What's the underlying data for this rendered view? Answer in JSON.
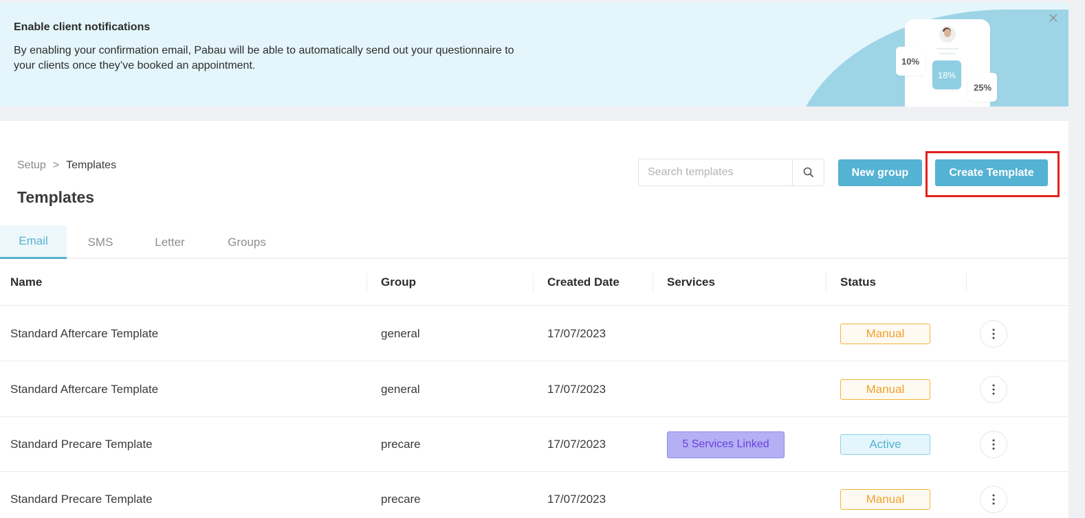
{
  "banner": {
    "title": "Enable client notifications",
    "text": "By enabling your confirmation email, Pabau will be able to automatically send out your questionnaire to your clients once they’ve booked an appointment.",
    "stats": [
      "10%",
      "18%",
      "25%"
    ]
  },
  "breadcrumb": {
    "parent": "Setup",
    "separator": ">",
    "current": "Templates"
  },
  "page_title": "Templates",
  "search": {
    "placeholder": "Search templates",
    "value": ""
  },
  "buttons": {
    "new_group": "New group",
    "create_template": "Create Template"
  },
  "tabs": [
    {
      "label": "Email",
      "active": true
    },
    {
      "label": "SMS",
      "active": false
    },
    {
      "label": "Letter",
      "active": false
    },
    {
      "label": "Groups",
      "active": false
    }
  ],
  "table": {
    "columns": [
      "Name",
      "Group",
      "Created Date",
      "Services",
      "Status"
    ],
    "rows": [
      {
        "name": "Standard Aftercare Template",
        "group": "general",
        "created": "17/07/2023",
        "services": "",
        "status": "Manual"
      },
      {
        "name": "Standard Aftercare Template",
        "group": "general",
        "created": "17/07/2023",
        "services": "",
        "status": "Manual"
      },
      {
        "name": "Standard Precare Template",
        "group": "precare",
        "created": "17/07/2023",
        "services": "5 Services Linked",
        "status": "Active"
      },
      {
        "name": "Standard Precare Template",
        "group": "precare",
        "created": "17/07/2023",
        "services": "",
        "status": "Manual"
      }
    ]
  },
  "colors": {
    "accent": "#54b2d3",
    "banner_bg": "#e4f6fb",
    "manual": "#eea12e",
    "services": "#6a3ee0",
    "highlight": "#e0201c"
  },
  "icons": {
    "close": "close-icon",
    "search": "search-icon",
    "row_menu": "more-vertical-icon"
  }
}
